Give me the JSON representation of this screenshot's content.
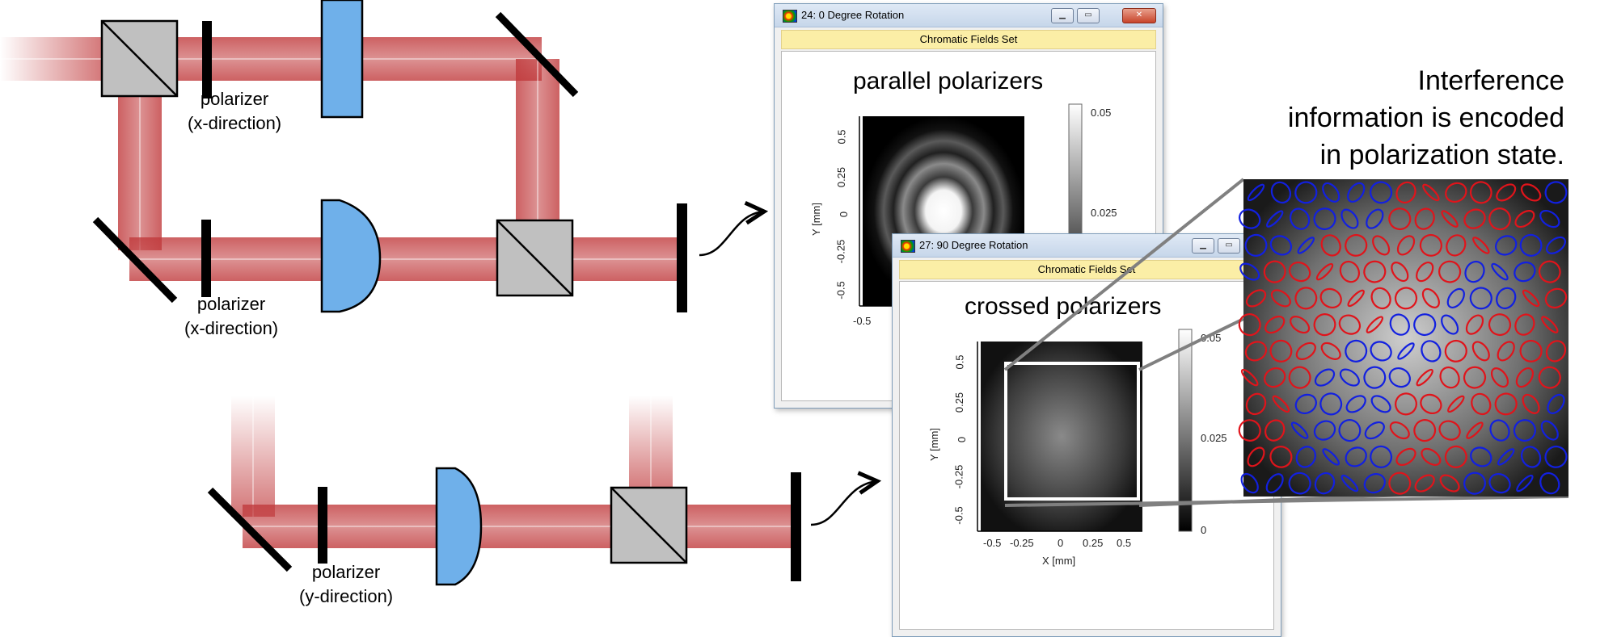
{
  "labels": {
    "top_polarizer": [
      "polarizer",
      "(x-direction)"
    ],
    "mid_polarizer": [
      "polarizer",
      "(x-direction)"
    ],
    "bottom_polarizer": [
      "polarizer",
      "(y-direction)"
    ]
  },
  "caption": [
    "Interference",
    "information is encoded",
    "in polarization state."
  ],
  "window1": {
    "title": "24: 0 Degree Rotation",
    "subheader": "Chromatic Fields Set",
    "plot_title": "parallel polarizers",
    "ylabel": "Y [mm]",
    "yticks": [
      "0.5",
      "0.25",
      "0",
      "-0.25",
      "-0.5"
    ],
    "xticks_visible": [
      "-0.5"
    ],
    "colorbar_ticks": [
      "0.05",
      "0.025"
    ]
  },
  "window2": {
    "title": "27: 90 Degree Rotation",
    "subheader": "Chromatic Fields Set",
    "plot_title": "crossed polarizers",
    "ylabel": "Y [mm]",
    "xlabel": "X [mm]",
    "yticks": [
      "0.5",
      "0.25",
      "0",
      "-0.25",
      "-0.5"
    ],
    "xticks": [
      "-0.5",
      "-0.25",
      "0",
      "0.25",
      "0.5"
    ],
    "colorbar_ticks": [
      "0.05",
      "0.025",
      "0"
    ]
  },
  "window_controls": {
    "minimize": "▁",
    "maximize": "▭",
    "close": "✕"
  },
  "colors": {
    "beam": "#c0393b",
    "lens": "#6fb0ea",
    "cube": "#c0c0c0",
    "ellipse_red": "#e0141b",
    "ellipse_blue": "#1220e0",
    "frame_win": "#7f9db9",
    "subheader": "#fbeea6"
  },
  "zoom_map": {
    "rows": [
      "BBBBBBRRRRRRB",
      "BBBBBBRRRRRRB",
      "BBBRRRRRRRBBB",
      "BRRRRRRRRBBBR",
      "RRRRRRRRBBBRR",
      "RRRRRRBBBRRRR",
      "RRRRBBBBRRRRR",
      "RRRBBBBRRRRRR",
      "RRBBBBRRRRRRB",
      "RRBBBBRRRRBBB",
      "RRBBBBRRRBBBB",
      "BBBBBBRRRBBBB"
    ]
  }
}
